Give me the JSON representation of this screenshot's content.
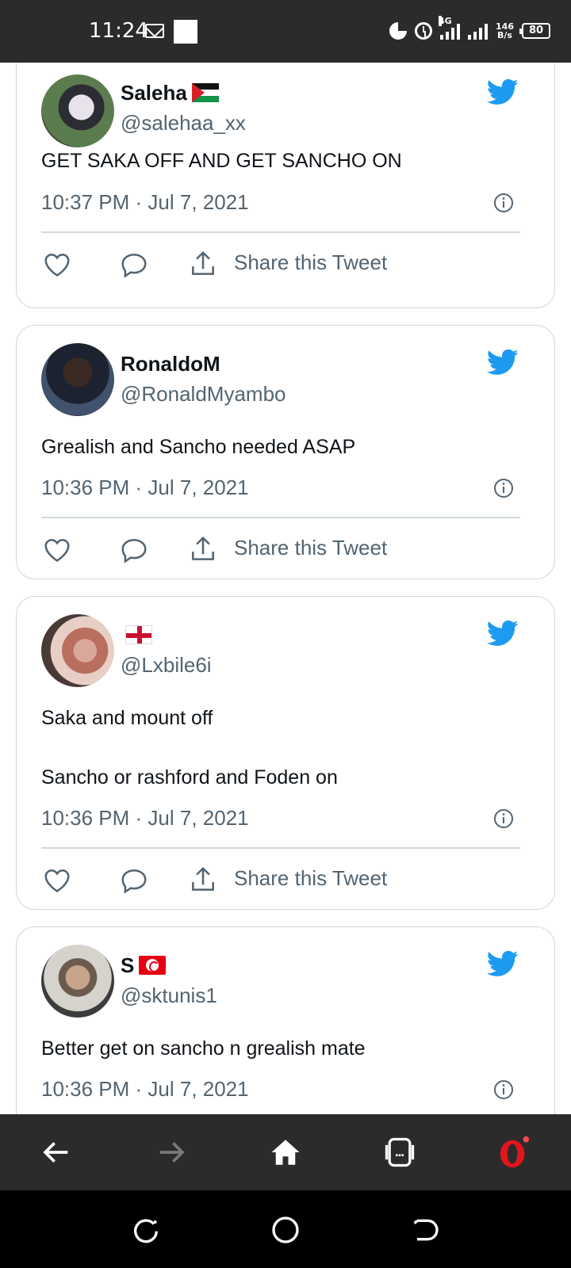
{
  "status_bar": {
    "time": "11:24",
    "network": "4G",
    "speed_top": "146",
    "speed_bottom": "B/s",
    "battery": "80"
  },
  "tweets": [
    {
      "name": "Saleha",
      "handle": "@salehaa_xx",
      "text": "GET SAKA OFF AND GET SANCHO ON",
      "timestamp": "10:37 PM · Jul 7, 2021",
      "share_label": "Share this Tweet"
    },
    {
      "name": "RonaldoM",
      "handle": "@RonaldMyambo",
      "text": "Grealish and Sancho needed ASAP",
      "timestamp": "10:36 PM · Jul 7, 2021",
      "share_label": "Share this Tweet"
    },
    {
      "name": "",
      "handle": "@Lxbile6i",
      "text_line1": "Saka and mount off",
      "text_line2": "Sancho or rashford and Foden on",
      "timestamp": "10:36 PM · Jul 7, 2021",
      "share_label": "Share this Tweet"
    },
    {
      "name": "S",
      "handle": "@sktunis1",
      "text": "Better get on sancho n grealish mate",
      "timestamp": "10:36 PM · Jul 7, 2021"
    }
  ],
  "colors": {
    "twitter_blue": "#1d9bf0",
    "secondary_text": "#536471",
    "border": "#cfd9de",
    "opera_red": "#e0161b"
  }
}
